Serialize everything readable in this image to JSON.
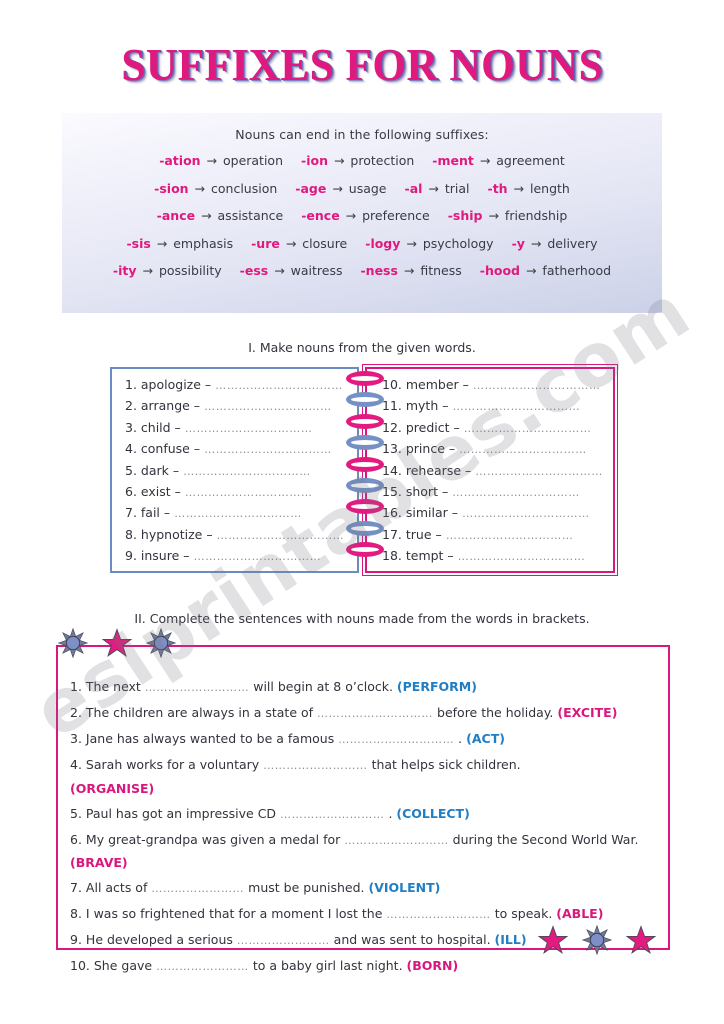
{
  "page": {
    "title": "SUFFIXES FOR NOUNS",
    "watermark": "eslprintables.com",
    "colors": {
      "pink": "#d9177e",
      "magenta": "#e0197e",
      "blue": "#6a8cc0",
      "cue_blue": "#1f7ec4",
      "text": "#33333d",
      "dots": "#8e8e98"
    }
  },
  "suffix_box": {
    "heading": "Nouns can end in the following suffixes:",
    "arrow": "→",
    "rows": [
      [
        {
          "suffix": "-ation",
          "example": "operation"
        },
        {
          "suffix": "-ion",
          "example": "protection"
        },
        {
          "suffix": "-ment",
          "example": "agreement"
        }
      ],
      [
        {
          "suffix": "-sion",
          "example": "conclusion"
        },
        {
          "suffix": "-age",
          "example": "usage"
        },
        {
          "suffix": "-al",
          "example": "trial"
        },
        {
          "suffix": "-th",
          "example": "length"
        }
      ],
      [
        {
          "suffix": "-ance",
          "example": "assistance"
        },
        {
          "suffix": "-ence",
          "example": "preference"
        },
        {
          "suffix": "-ship",
          "example": "friendship"
        }
      ],
      [
        {
          "suffix": "-sis",
          "example": "emphasis"
        },
        {
          "suffix": "-ure",
          "example": "closure"
        },
        {
          "suffix": "-logy",
          "example": "psychology"
        },
        {
          "suffix": "-y",
          "example": "delivery"
        }
      ],
      [
        {
          "suffix": "-ity",
          "example": "possibility"
        },
        {
          "suffix": "-ess",
          "example": "waitress"
        },
        {
          "suffix": "-ness",
          "example": "fitness"
        },
        {
          "suffix": "-hood",
          "example": "fatherhood"
        }
      ]
    ]
  },
  "exercise1": {
    "heading": "I. Make nouns from the given words.",
    "dots": "……………………………",
    "left_items": [
      "1. apologize –",
      "2. arrange –",
      "3. child –",
      "4. confuse –",
      "5. dark –",
      "6. exist –",
      "7. fail –",
      "8. hypnotize –",
      "9. insure –"
    ],
    "right_items": [
      "10. member –",
      "11. myth –",
      "12. predict –",
      "13. prince –",
      "14. rehearse –",
      "15. short –",
      "16. similar –",
      "17. true –",
      "18. tempt –"
    ],
    "ring_colors": [
      "pink",
      "blue",
      "pink",
      "blue",
      "pink",
      "blue",
      "pink",
      "blue",
      "pink",
      "blue"
    ]
  },
  "exercise2": {
    "heading": "II. Complete the sentences with nouns made from the words in brackets.",
    "sentences": [
      {
        "number": "1.",
        "before": "The next",
        "blank": "………………………",
        "after": "will begin at 8 o’clock.",
        "cue": "(PERFORM)",
        "cue_color": "blue"
      },
      {
        "number": "2.",
        "before": "The children are always in a state of",
        "blank": "…………………………",
        "after": "before the holiday.",
        "cue": "(EXCITE)",
        "cue_color": "pink"
      },
      {
        "number": "3.",
        "before": "Jane has always wanted to be a famous",
        "blank": "…………………………",
        "after": ".",
        "cue": "(ACT)",
        "cue_color": "blue"
      },
      {
        "number": "4.",
        "before": "Sarah works for a voluntary",
        "blank": "………………………",
        "after": "that helps sick children.",
        "cue": "(ORGANISE)",
        "cue_color": "pink",
        "cue_on_new_line": true
      },
      {
        "number": "5.",
        "before": "Paul has got an impressive CD",
        "blank": "………………………",
        "after": ".",
        "cue": "(COLLECT)",
        "cue_color": "blue"
      },
      {
        "number": "6.",
        "before": "My great-grandpa was given a medal for",
        "blank": "………………………",
        "after": "during the Second World War.",
        "cue": "(BRAVE)",
        "cue_color": "pink"
      },
      {
        "number": "7.",
        "before": "All acts of",
        "blank": "……………………",
        "after": "must be punished.",
        "cue": "(VIOLENT)",
        "cue_color": "blue"
      },
      {
        "number": "8.",
        "before": "I was so frightened that for a moment I lost the",
        "blank": "………………………",
        "after": "to speak.",
        "cue": "(ABLE)",
        "cue_color": "pink"
      },
      {
        "number": "9.",
        "before": "He developed a serious",
        "blank": "……………………",
        "after": "and was sent to hospital.",
        "cue": "(ILL)",
        "cue_color": "blue"
      },
      {
        "number": "10.",
        "before": "She gave",
        "blank": "……………………",
        "after": "to a baby girl last night.",
        "cue": "(BORN)",
        "cue_color": "pink"
      }
    ]
  },
  "decorations": {
    "top_left_stars": [
      "burst-blue",
      "star-pink",
      "burst-blue"
    ],
    "bottom_right_stars": [
      "star-pink",
      "burst-blue",
      "star-pink"
    ]
  }
}
